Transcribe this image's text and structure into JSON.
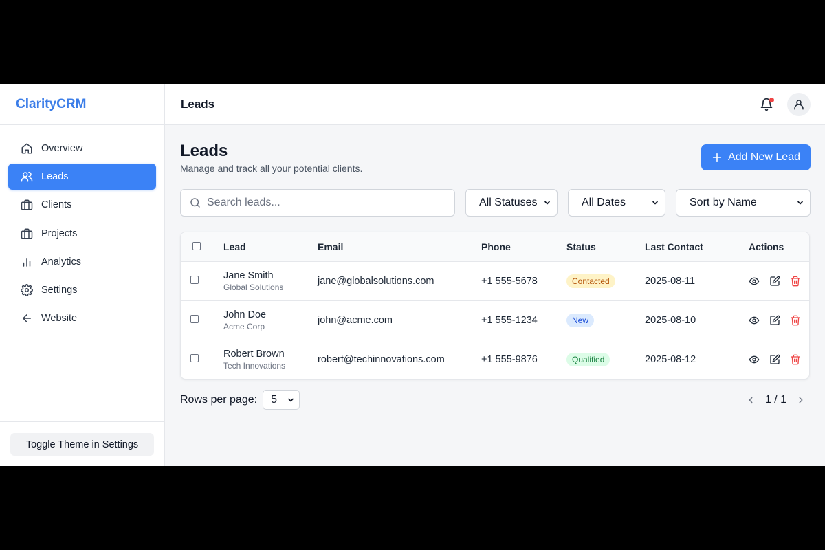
{
  "app": {
    "brand": "ClarityCRM"
  },
  "sidebar": {
    "items": [
      {
        "label": "Overview",
        "icon": "home-icon",
        "active": false
      },
      {
        "label": "Leads",
        "icon": "users-icon",
        "active": true
      },
      {
        "label": "Clients",
        "icon": "briefcase-icon",
        "active": false
      },
      {
        "label": "Projects",
        "icon": "briefcase-icon",
        "active": false
      },
      {
        "label": "Analytics",
        "icon": "bar-chart-icon",
        "active": false
      },
      {
        "label": "Settings",
        "icon": "gear-icon",
        "active": false
      },
      {
        "label": "Website",
        "icon": "arrow-left-icon",
        "active": false
      }
    ],
    "footer_button": "Toggle Theme in Settings"
  },
  "topbar": {
    "title": "Leads",
    "notification_dot_color": "#ef4444"
  },
  "page": {
    "title": "Leads",
    "subtitle": "Manage and track all your potential clients.",
    "add_button": "Add New Lead"
  },
  "filters": {
    "search_placeholder": "Search leads...",
    "status": "All Statuses",
    "date": "All Dates",
    "sort": "Sort by Name"
  },
  "table": {
    "headers": [
      "Lead",
      "Email",
      "Phone",
      "Status",
      "Last Contact",
      "Actions"
    ],
    "rows": [
      {
        "name": "Jane Smith",
        "company": "Global Solutions",
        "email": "jane@globalsolutions.com",
        "phone": "+1 555-5678",
        "status": "Contacted",
        "last_contact": "2025-08-11"
      },
      {
        "name": "John Doe",
        "company": "Acme Corp",
        "email": "john@acme.com",
        "phone": "+1 555-1234",
        "status": "New",
        "last_contact": "2025-08-10"
      },
      {
        "name": "Robert Brown",
        "company": "Tech Innovations",
        "email": "robert@techinnovations.com",
        "phone": "+1 555-9876",
        "status": "Qualified",
        "last_contact": "2025-08-12"
      }
    ]
  },
  "status_colors": {
    "Contacted": {
      "bg": "#fef3c7",
      "fg": "#b45309"
    },
    "New": {
      "bg": "#dbeafe",
      "fg": "#1d4ed8"
    },
    "Qualified": {
      "bg": "#dcfce7",
      "fg": "#15803d"
    }
  },
  "pagination": {
    "rows_label": "Rows per page:",
    "rows_value": "5",
    "page_info": "1 / 1"
  },
  "colors": {
    "accent": "#3b82f6",
    "brand": "#3b7de8",
    "delete": "#ef4444"
  }
}
